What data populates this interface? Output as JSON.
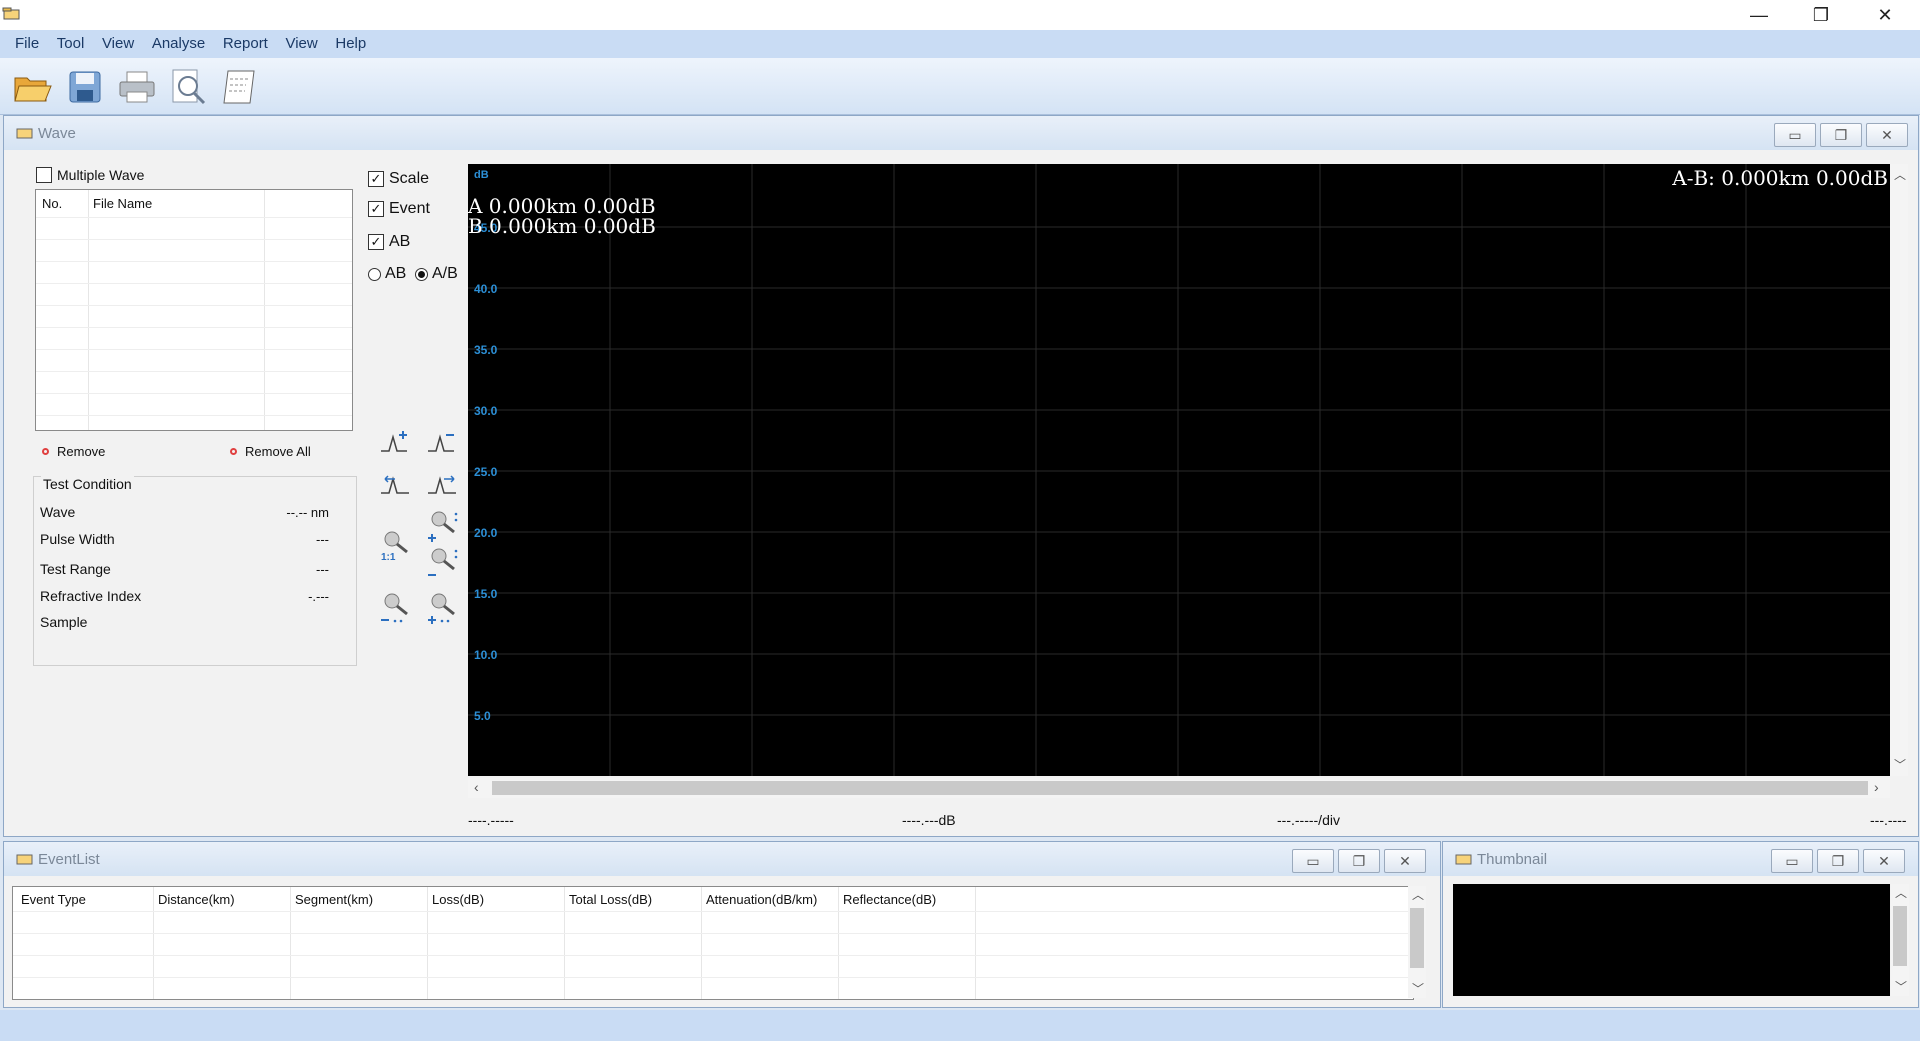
{
  "window": {
    "minimize": "—",
    "restore": "❐",
    "close": "✕"
  },
  "menu": [
    "File",
    "Tool",
    "View",
    "Analyse",
    "Report",
    "View",
    "Help"
  ],
  "toolbar": [
    {
      "name": "open-icon"
    },
    {
      "name": "save-icon"
    },
    {
      "name": "print-icon"
    },
    {
      "name": "print-preview-icon"
    },
    {
      "name": "report-icon"
    }
  ],
  "wave_panel": {
    "title": "Wave",
    "multiple_wave": "Multiple Wave",
    "columns": [
      "No.",
      "File Name"
    ],
    "remove": "Remove",
    "remove_all": "Remove All",
    "test_condition": {
      "title": "Test Condition",
      "rows": [
        {
          "label": "Wave",
          "value": "--.-- nm"
        },
        {
          "label": "Pulse Width",
          "value": "---"
        },
        {
          "label": "Test Range",
          "value": "---"
        },
        {
          "label": "Refractive Index",
          "value": "-.---"
        },
        {
          "label": "Sample",
          "value": ""
        }
      ]
    },
    "options": {
      "scale": "Scale",
      "event": "Event",
      "ab": "AB",
      "radio_ab": "AB",
      "radio_a_b": "A/B"
    },
    "plot": {
      "y_unit": "dB",
      "y_ticks": [
        "45.0",
        "40.0",
        "35.0",
        "30.0",
        "25.0",
        "20.0",
        "15.0",
        "10.0",
        "5.0"
      ],
      "cursor_a": "A 0.000km 0.00dB",
      "cursor_b": "B 0.000km 0.00dB",
      "a_minus_b": "A-B: 0.000km 0.00dB"
    },
    "status": [
      "----.-----",
      "----.---dB",
      "---.-----/div",
      "---.----"
    ]
  },
  "event_panel": {
    "title": "EventList",
    "columns": [
      "Event Type",
      "Distance(km)",
      "Segment(km)",
      "Loss(dB)",
      "Total Loss(dB)",
      "Attenuation(dB/km)",
      "Reflectance(dB)"
    ]
  },
  "thumbnail_panel": {
    "title": "Thumbnail"
  }
}
